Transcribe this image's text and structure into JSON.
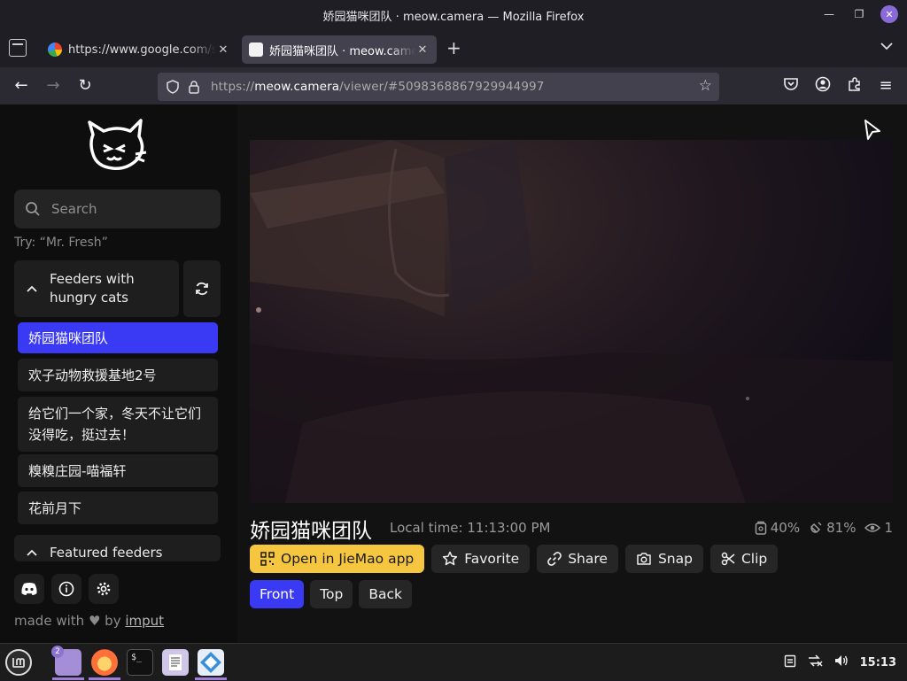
{
  "window": {
    "title": "娇园猫咪团队 · meow.camera — Mozilla Firefox"
  },
  "tabs": [
    {
      "label": "https://www.google.com/search",
      "active": false
    },
    {
      "label": "娇园猫咪团队 · meow.camera",
      "active": true
    }
  ],
  "urlbar": {
    "scheme": "https://",
    "host": "meow.camera",
    "path": "/viewer/#5098368867929944997"
  },
  "sidebar": {
    "search_placeholder": "Search",
    "hint": "Try: “Mr. Fresh”",
    "group1_title": "Feeders with hungry cats",
    "feeders": [
      {
        "label": "娇园猫咪团队",
        "active": true
      },
      {
        "label": "欢子动物救援基地2号",
        "active": false
      },
      {
        "label": "给它们一个家，冬天不让它们没得吃，挺过去！",
        "active": false
      },
      {
        "label": "糗糗庄园-喵福轩",
        "active": false
      },
      {
        "label": "花前月下",
        "active": false
      }
    ],
    "group2_title": "Featured feeders",
    "made_with_prefix": "made with",
    "made_with_by": "by",
    "made_with_author": "imput"
  },
  "camera": {
    "title": "娇园猫咪团队",
    "local_time": "Local time: 11:13:00 PM",
    "stats": {
      "food": "40%",
      "battery": "81%",
      "viewers": "1"
    },
    "actions": {
      "open_app": "Open in JieMao app",
      "favorite": "Favorite",
      "share": "Share",
      "snap": "Snap",
      "clip": "Clip"
    },
    "views": [
      {
        "label": "Front",
        "active": true
      },
      {
        "label": "Top",
        "active": false
      },
      {
        "label": "Back",
        "active": false
      }
    ]
  },
  "taskbar": {
    "files_badge": "2",
    "clock": "15:13"
  },
  "colors": {
    "accent_blue": "#3a3af5",
    "accent_yellow": "#f7c640",
    "firefox_purple": "#8a6ad8"
  }
}
